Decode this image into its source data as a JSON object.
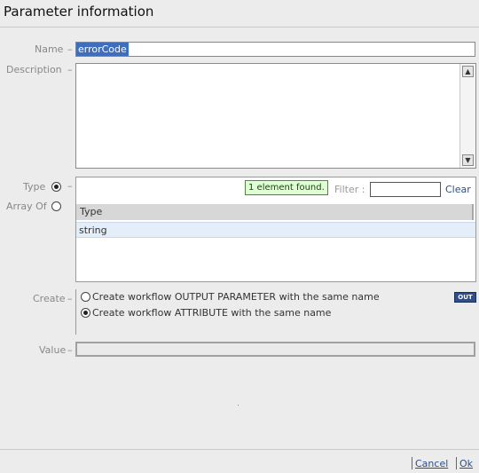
{
  "dialog": {
    "title": "Parameter information"
  },
  "labels": {
    "name": "Name",
    "description": "Description",
    "type": "Type",
    "array_of": "Array Of",
    "create": "Create",
    "value": "Value",
    "separator": "–"
  },
  "name_field": {
    "value": "errorCode"
  },
  "description_field": {
    "value": ""
  },
  "type_panel": {
    "found_tooltip": "1 element found.",
    "filter_label": "Filter :",
    "filter_value": "",
    "clear_label": "Clear",
    "column_header": "Type",
    "rows": [
      "string"
    ]
  },
  "create_options": {
    "output_parameter": "Create workflow OUTPUT PARAMETER with the same name",
    "attribute": "Create workflow ATTRIBUTE with the same name",
    "selected": "attribute",
    "out_badge": "OUT"
  },
  "value_field": {
    "value": ""
  },
  "footer": {
    "cancel": "Cancel",
    "ok": "Ok"
  }
}
